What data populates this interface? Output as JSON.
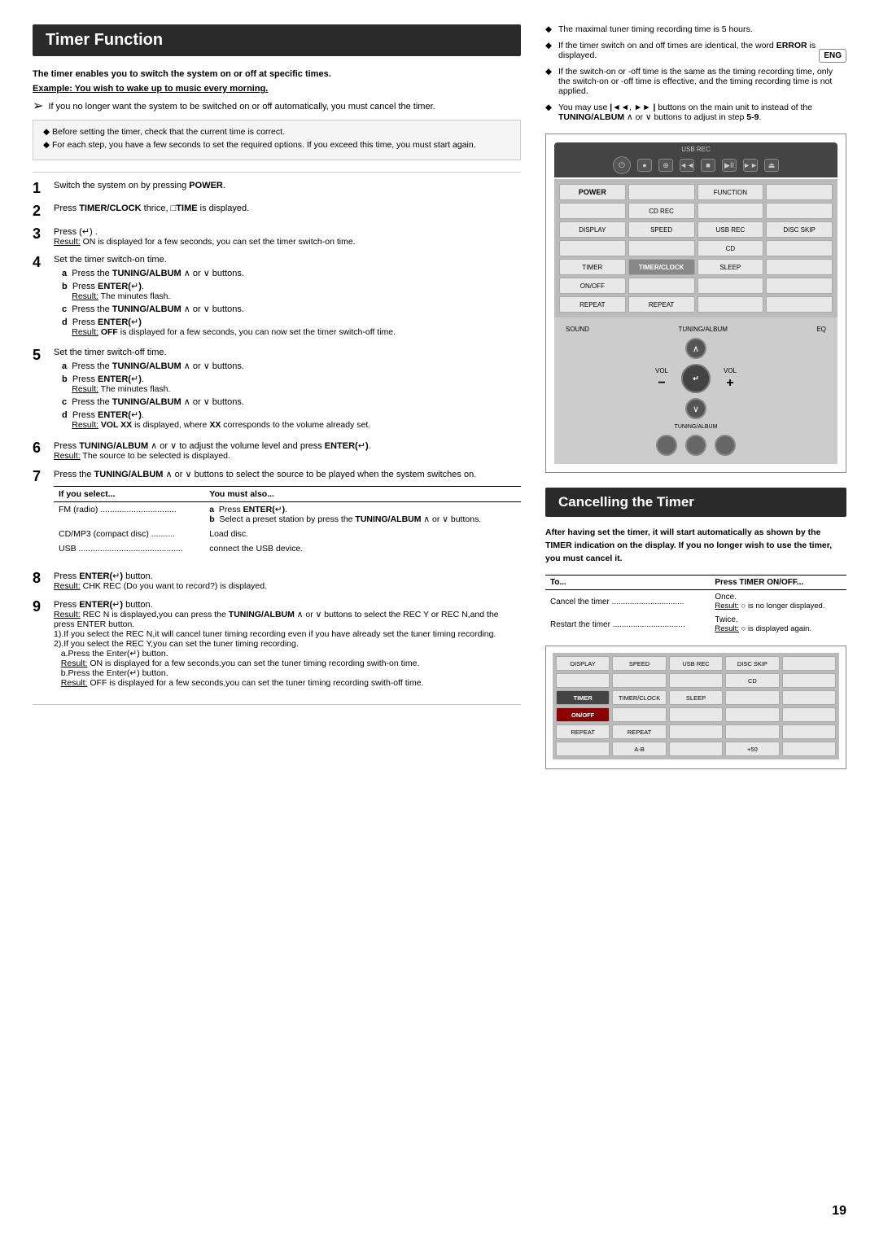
{
  "page": {
    "title": "Timer Function",
    "cancelling_title": "Cancelling the Timer",
    "eng_badge": "ENG",
    "page_number": "19"
  },
  "intro": {
    "bold_text": "The timer enables you to switch the system on or off at specific times.",
    "example_label": "Example:",
    "example_text": " You wish to wake up to music every morning."
  },
  "notice": {
    "arrow_text": "If you no longer want the system to be switched on or off automatically, you must cancel the timer."
  },
  "note": {
    "line1": "◆ Before setting the timer, check that the current time is correct.",
    "line2": "◆ For each step, you have a few seconds to set the required options. If you exceed this time, you must start again."
  },
  "steps": [
    {
      "number": "1",
      "text": "Switch the system on by pressing POWER."
    },
    {
      "number": "2",
      "text": "Press TIMER/CLOCK thrice, □TIME is displayed."
    },
    {
      "number": "3",
      "text": "Press (↵).",
      "result": "Result: ON is displayed for a few seconds, you can set the timer switch-on time."
    },
    {
      "number": "4",
      "text": "Set the timer switch-on time.",
      "sub": [
        {
          "label": "a",
          "text": "Press the TUNING/ALBUM ∧ or ∨ buttons."
        },
        {
          "label": "b",
          "text": "Press ENTER(↵).",
          "result": "Result: The minutes flash."
        },
        {
          "label": "c",
          "text": "Press the TUNING/ALBUM ∧ or ∨ buttons."
        },
        {
          "label": "d",
          "text": "Press ENTER(↵)",
          "result": "Result: OFF is displayed for a few seconds, you can now set the timer switch-off time."
        }
      ]
    },
    {
      "number": "5",
      "text": "Set the timer switch-off time.",
      "sub": [
        {
          "label": "a",
          "text": "Press the TUNING/ALBUM ∧ or ∨ buttons."
        },
        {
          "label": "b",
          "text": "Press ENTER(↵).",
          "result": "Result: The minutes flash."
        },
        {
          "label": "c",
          "text": "Press the TUNING/ALBUM ∧ or ∨ buttons."
        },
        {
          "label": "d",
          "text": "Press ENTER(↵).",
          "result": "Result: VOL XX is displayed, where XX corresponds to the volume already set."
        }
      ]
    },
    {
      "number": "6",
      "text": "Press TUNING/ALBUM ∧ or ∨ to adjust the volume level and press ENTER(↵).",
      "result": "Result: The source to be selected is displayed."
    },
    {
      "number": "7",
      "text": "Press the TUNING/ALBUM ∧ or ∨ buttons to select the source to be played when the system switches on.",
      "table": {
        "col1": "If you select...",
        "col2": "You must also...",
        "rows": [
          {
            "source": "FM (radio)",
            "action": "a  Press ENTER(↵).\nb  Select a preset station by press the TUNING/ALBUM ∧ or ∨ buttons."
          },
          {
            "source": "CD/MP3 (compact disc)",
            "action": "Load disc."
          },
          {
            "source": "USB",
            "action": "connect the USB device."
          }
        ]
      }
    },
    {
      "number": "8",
      "text": "Press ENTER(↵) button.",
      "result": "Result: CHK REC (Do you want to record?) is displayed."
    },
    {
      "number": "9",
      "text": "Press ENTER(↵) button.",
      "result": "Result: REC N is displayed,you can press the TUNING/ALBUM ∧ or ∨ buttons to select the REC Y or REC N,and the press ENTER button.\n1).If you select the REC N,it will cancel tuner timing recording even if you have already set the tuner timing recording.\n2).If you select the REC Y,you can set the tuner timing recording.\na.Press the Enter(↵) button.\nResult: ON is displayed for a few seconds,you can set the tuner timing recording swith-on time.\nb.Press the Enter(↵) button.\nResult: OFF is displayed for a few seconds,you can set the tuner timing recording swith-off time."
    }
  ],
  "right_bullets": [
    "The maximal tuner timing recording time is 5 hours.",
    "If the timer switch on and off times are identical, the word ERROR is displayed.",
    "If the switch-on or -off time is the same as the timing recording time, only the switch-on or -off time is effective, and the timing recording time is not applied.",
    "You may use |◄◄, ►►| buttons on the main unit to instead of the TUNING/ALBUM ∧ or ∨ buttons to adjust in step 5-9."
  ],
  "remote_keys_top": {
    "label": "USB REC",
    "buttons": [
      "⏻",
      "●",
      "⊕",
      "◄◄",
      "■",
      "►/II",
      "►►",
      "⏏"
    ]
  },
  "remote_grid": {
    "rows": [
      [
        "POWER",
        "",
        "FUNCTION",
        ""
      ],
      [
        "",
        "CD REC",
        "",
        ""
      ],
      [
        "DISPLAY",
        "SPEED",
        "USB REC",
        "DISC SKIP"
      ],
      [
        "",
        "",
        "CD",
        ""
      ],
      [
        "TIMER",
        "TIMER/CLOCK",
        "SLEEP",
        ""
      ],
      [
        "ON/OFF",
        "",
        "",
        ""
      ],
      [
        "REPEAT",
        "REPEAT",
        "",
        ""
      ],
      [
        "SOUND",
        "TUNING/ALBUM",
        "EQ",
        ""
      ]
    ]
  },
  "cancelling": {
    "title": "Cancelling the Timer",
    "desc": "After having set the timer, it will start automatically as shown by the TIMER indication on the display. If you no longer wish to use the timer, you must cancel it.",
    "table": {
      "col1": "To...",
      "col2": "Press TIMER ON/OFF...",
      "rows": [
        {
          "action": "Cancel the timer",
          "press": "Once.",
          "result": "Result: ○ is no longer displayed."
        },
        {
          "action": "Restart the timer",
          "press": "Twice.",
          "result": "Result: ○ is displayed again."
        }
      ]
    }
  },
  "remote2_grid": {
    "rows": [
      [
        "DISPLAY",
        "SPEED",
        "USB REC",
        "DISC SKIP",
        ""
      ],
      [
        "",
        "",
        "",
        "CD",
        ""
      ],
      [
        "TIMER",
        "TIMER/CLOCK",
        "SLEEP",
        "",
        ""
      ],
      [
        "ON/OFF",
        "",
        "",
        "",
        ""
      ],
      [
        "REPEAT",
        "REPEAT",
        "",
        "",
        ""
      ],
      [
        "",
        "A-B",
        "",
        "+50",
        ""
      ]
    ]
  }
}
